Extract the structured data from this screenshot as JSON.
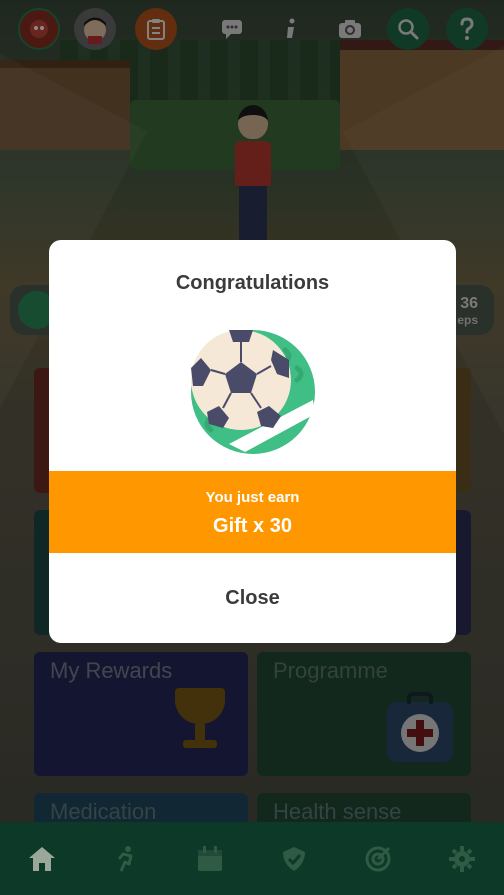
{
  "top_bar": {
    "icons": [
      "avatar-badge-icon",
      "profile-face-icon",
      "clipboard-icon",
      "chat-icon",
      "info-icon",
      "camera-icon",
      "search-icon",
      "help-icon"
    ]
  },
  "profile_strip": {
    "steps_number": "36",
    "steps_label": "eps"
  },
  "tiles": {
    "rewards_label": "My Rewards",
    "programme_label": "Programme",
    "medication_label": "Medication",
    "health_label": "Health sense"
  },
  "modal": {
    "title": "Congratulations",
    "earn_text": "You just earn",
    "gift_text": "Gift x 30",
    "close_label": "Close",
    "accent_color": "#ff9800"
  },
  "tab_bar": {
    "tabs": [
      "home-icon",
      "activity-icon",
      "calendar-icon",
      "shield-check-icon",
      "goal-icon",
      "settings-gear-icon"
    ]
  }
}
